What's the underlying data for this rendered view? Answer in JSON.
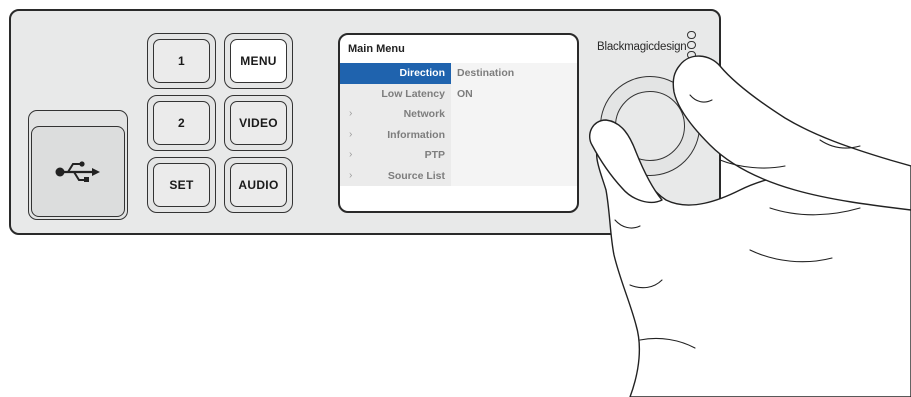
{
  "device": {
    "brand": "Blackmagicdesign",
    "usb_port": {
      "icon": "usb-icon"
    },
    "buttons": {
      "b1": "1",
      "b2": "2",
      "set": "SET",
      "menu": "MENU",
      "video": "VIDEO",
      "audio": "AUDIO"
    },
    "led_count": 3,
    "knob": {
      "icon": "rotary-knob"
    }
  },
  "screen": {
    "title": "Main Menu",
    "rows": [
      {
        "label": "Direction",
        "value": "Destination",
        "selected": true,
        "chevron": ""
      },
      {
        "label": "Low Latency",
        "value": "ON",
        "selected": false,
        "chevron": ""
      },
      {
        "label": "Network",
        "value": "",
        "selected": false,
        "chevron": "›"
      },
      {
        "label": "Information",
        "value": "",
        "selected": false,
        "chevron": "›"
      },
      {
        "label": "PTP",
        "value": "",
        "selected": false,
        "chevron": "›"
      },
      {
        "label": "Source List",
        "value": "",
        "selected": false,
        "chevron": "›"
      }
    ]
  },
  "colors": {
    "selection": "#1f63ae",
    "panel": "#e8e9e9",
    "outline": "#2a2a2a"
  }
}
